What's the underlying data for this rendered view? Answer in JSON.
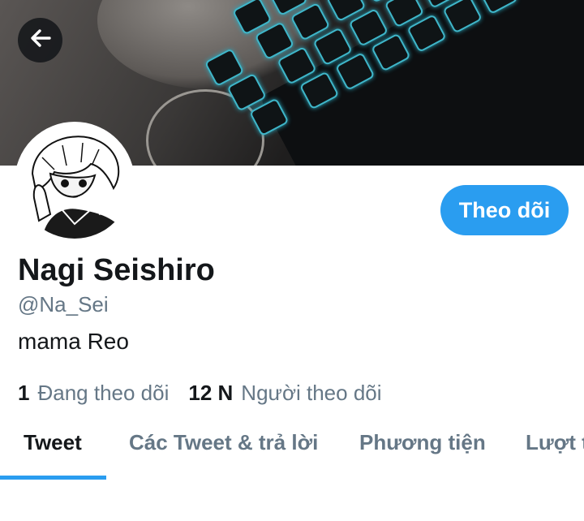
{
  "header": {
    "back_icon": "arrow-left-icon"
  },
  "profile": {
    "name": "Nagi Seishiro",
    "handle": "@Na_Sei",
    "bio": "mama Reo",
    "follow_label": "Theo dõi"
  },
  "stats": {
    "following_count": "1",
    "following_label": "Đang theo dõi",
    "followers_count": "12 N",
    "followers_label": "Người theo dõi"
  },
  "tabs": [
    {
      "label": "Tweet",
      "active": true
    },
    {
      "label": "Các Tweet & trả lời",
      "active": false
    },
    {
      "label": "Phương tiện",
      "active": false
    },
    {
      "label": "Lượt t",
      "active": false
    }
  ],
  "colors": {
    "accent": "#2a9df0",
    "secondary_text": "#657786",
    "primary_text": "#14171a"
  }
}
